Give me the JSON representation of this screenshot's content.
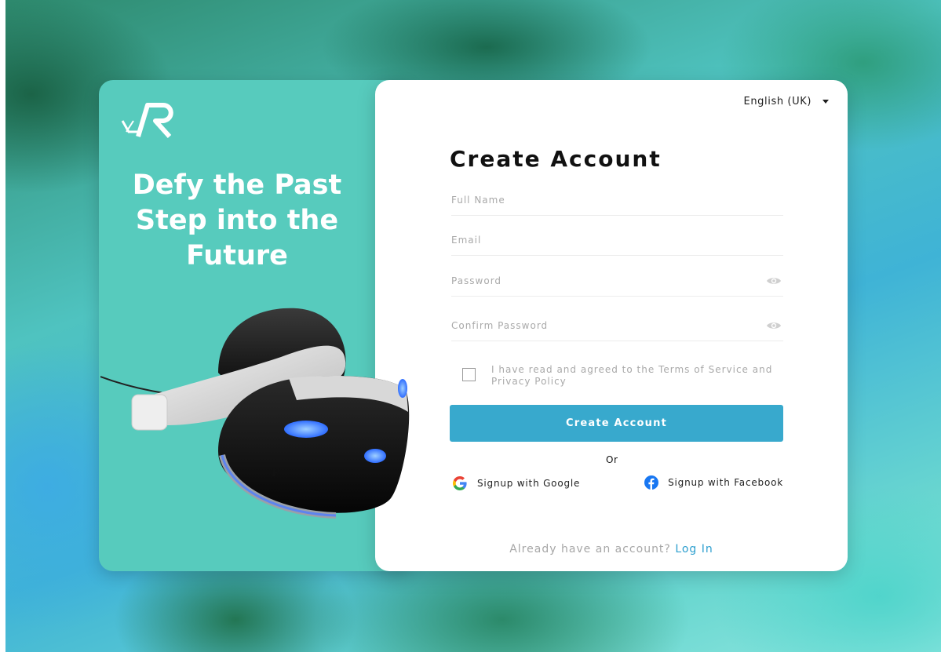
{
  "app": {
    "tagline_lines": [
      "Defy the Past",
      "Step into the",
      "Future"
    ]
  },
  "header": {
    "language": "English (UK)"
  },
  "form": {
    "title": "Create Account",
    "full_name_placeholder": "Full Name",
    "email_placeholder": "Email",
    "password_placeholder": "Password",
    "confirm_password_placeholder": "Confirm Password",
    "terms_text": "I have read and agreed to the Terms of Service and Privacy Policy",
    "submit_label": "Create Account",
    "or_label": "Or",
    "google_label": "Signup with Google",
    "facebook_label": "Signup with Facebook",
    "login_prompt": "Already have an account?",
    "login_link": "Log In"
  },
  "colors": {
    "panel_teal": "#57cbbd",
    "button_blue": "#38a9cd",
    "link_blue": "#2d9fcf"
  },
  "icons": [
    "vr-logo-icon",
    "chevron-down-icon",
    "eye-icon",
    "checkbox-icon",
    "google-icon",
    "facebook-icon"
  ]
}
